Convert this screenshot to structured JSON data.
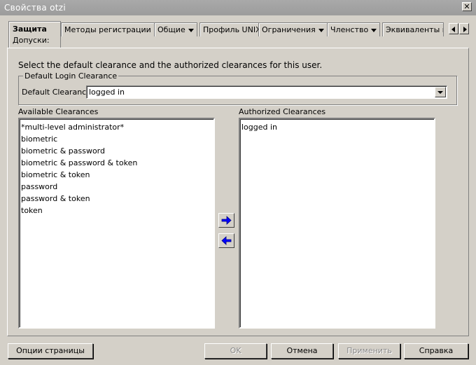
{
  "window": {
    "title": "Свойства   otzi",
    "close_glyph": "✕"
  },
  "tabs": {
    "active": {
      "label": "Защита",
      "sub_label": "Допуски:"
    },
    "items": [
      {
        "label": "Методы регистрации",
        "has_dropdown": true
      },
      {
        "label": "Общие",
        "has_dropdown": true
      },
      {
        "label": "Профиль UNIX",
        "has_dropdown": false
      },
      {
        "label": "Ограничения",
        "has_dropdown": true
      },
      {
        "label": "Членство",
        "has_dropdown": true
      },
      {
        "label": "Эквиваленты п",
        "has_dropdown": false
      }
    ]
  },
  "instruction": "Select the default clearance and the authorized clearances for this user.",
  "default_login": {
    "group_title": "Default Login Clearance",
    "field_label": "Default Clearance:",
    "selected_value": "logged in"
  },
  "available": {
    "label": "Available Clearances",
    "items": [
      "*multi-level administrator*",
      "biometric",
      "biometric & password",
      "biometric & password & token",
      "biometric & token",
      "password",
      "password & token",
      "token"
    ]
  },
  "authorized": {
    "label": "Authorized Clearances",
    "items": [
      "logged in"
    ]
  },
  "icons": {
    "add": "arrow-right-icon",
    "remove": "arrow-left-icon",
    "arrow_color": "#0000ff"
  },
  "buttons": {
    "page_options": "Опции страницы",
    "ok": "OK",
    "cancel": "Отмена",
    "apply": "Применить",
    "help": "Справка"
  },
  "colors": {
    "dialog_bg": "#d4d0c8",
    "titlebar": "#a0a0a0",
    "disabled_text": "#8a8a8a"
  }
}
